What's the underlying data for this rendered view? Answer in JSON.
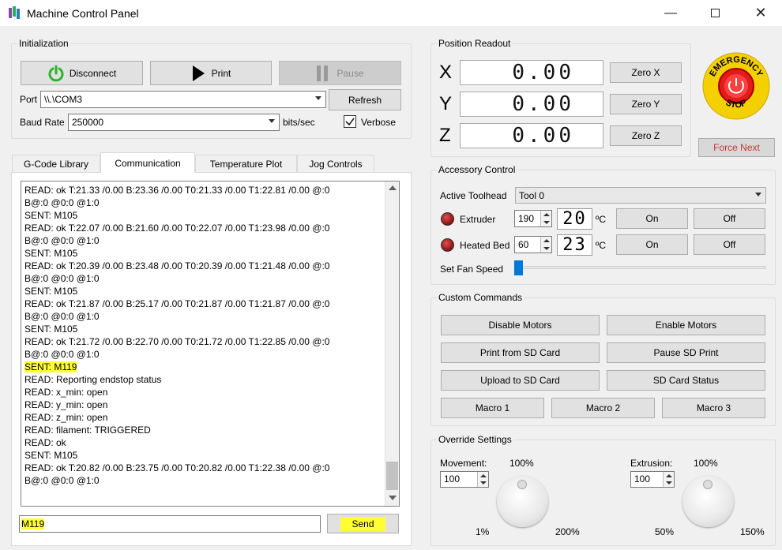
{
  "window": {
    "title": "Machine Control Panel"
  },
  "init": {
    "legend": "Initialization",
    "disconnect": "Disconnect",
    "print": "Print",
    "pause": "Pause",
    "port_label": "Port",
    "port_value": "\\\\.\\COM3",
    "refresh": "Refresh",
    "baud_label": "Baud Rate",
    "baud_value": "250000",
    "baud_unit": "bits/sec",
    "verbose": "Verbose"
  },
  "tabs": [
    "G-Code Library",
    "Communication",
    "Temperature Plot",
    "Jog Controls"
  ],
  "log": [
    "READ: ok T:21.33 /0.00 B:23.36 /0.00 T0:21.33 /0.00 T1:22.81 /0.00 @:0",
    "B@:0 @0:0 @1:0",
    "SENT: M105",
    "READ: ok T:22.07 /0.00 B:21.60 /0.00 T0:22.07 /0.00 T1:23.98 /0.00 @:0",
    "B@:0 @0:0 @1:0",
    "SENT: M105",
    "READ: ok T:20.39 /0.00 B:23.48 /0.00 T0:20.39 /0.00 T1:21.48 /0.00 @:0",
    "B@:0 @0:0 @1:0",
    "SENT: M105",
    "READ: ok T:21.87 /0.00 B:25.17 /0.00 T0:21.87 /0.00 T1:21.87 /0.00 @:0",
    "B@:0 @0:0 @1:0",
    "SENT: M105",
    "READ: ok T:21.72 /0.00 B:22.70 /0.00 T0:21.72 /0.00 T1:22.85 /0.00 @:0",
    "B@:0 @0:0 @1:0",
    "SENT: M119",
    "READ: Reporting endstop status",
    "READ: x_min: open",
    "READ: y_min: open",
    "READ: z_min: open",
    "READ: filament: TRIGGERED",
    "READ: ok",
    "SENT: M105",
    "READ: ok T:20.82 /0.00 B:23.75 /0.00 T0:20.82 /0.00 T1:22.38 /0.00 @:0",
    "B@:0 @0:0 @1:0"
  ],
  "command": {
    "value": "M119",
    "send": "Send"
  },
  "position": {
    "legend": "Position Readout",
    "x_label": "X",
    "y_label": "Y",
    "z_label": "Z",
    "x_value": "0.00",
    "y_value": "0.00",
    "z_value": "0.00",
    "zero_x": "Zero X",
    "zero_y": "Zero Y",
    "zero_z": "Zero Z"
  },
  "emergency": {
    "top": "EMERGENCY",
    "bottom": "STOP",
    "force_next": "Force Next"
  },
  "accessory": {
    "legend": "Accessory Control",
    "toolhead_label": "Active Toolhead",
    "toolhead_value": "Tool 0",
    "extruder_label": "Extruder",
    "extruder_target": "190",
    "extruder_temp": "20",
    "bed_label": "Heated Bed",
    "bed_target": "60",
    "bed_temp": "23",
    "unit": "ºC",
    "on": "On",
    "off": "Off",
    "fan_label": "Set Fan Speed",
    "fan_level": 0
  },
  "custom": {
    "legend": "Custom Commands",
    "disable_motors": "Disable Motors",
    "enable_motors": "Enable Motors",
    "print_sd": "Print from SD Card",
    "pause_sd": "Pause SD Print",
    "upload_sd": "Upload to SD Card",
    "sd_status": "SD Card Status",
    "macro1": "Macro 1",
    "macro2": "Macro 2",
    "macro3": "Macro 3"
  },
  "override": {
    "legend": "Override Settings",
    "movement_label": "Movement:",
    "movement_pct": "100%",
    "movement_value": "100",
    "movement_min": "1%",
    "movement_max": "200%",
    "extrusion_label": "Extrusion:",
    "extrusion_pct": "100%",
    "extrusion_value": "100",
    "extrusion_min": "50%",
    "extrusion_max": "150%"
  },
  "colors": {
    "highlight": "#ffff33",
    "power_green": "#2bb52b",
    "force_next_text": "#c0392b"
  }
}
